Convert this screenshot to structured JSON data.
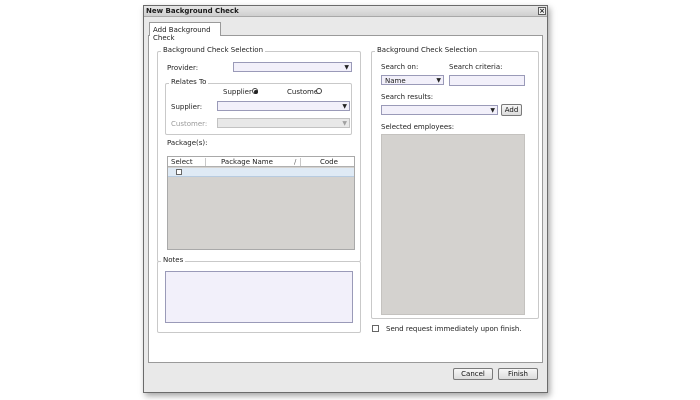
{
  "window": {
    "title": "New Background Check",
    "close_glyph": "×"
  },
  "tabs": [
    {
      "label": "Add Background Check"
    }
  ],
  "left_group": {
    "title": "Background Check Selection",
    "provider_label": "Provider:",
    "provider_value": "",
    "relates_to": {
      "title": "Relates To",
      "supplier_option": "Supplier",
      "customer_option": "Customer",
      "selected": "Supplier",
      "supplier_label": "Supplier:",
      "supplier_value": "",
      "customer_label": "Customer:",
      "customer_value": ""
    },
    "packages_label": "Package(s):",
    "packages_table": {
      "columns": [
        "Select",
        "Package Name",
        "Code"
      ],
      "sort_glyph": "/",
      "rows": [
        {
          "selected": false,
          "name": "",
          "code": ""
        }
      ]
    }
  },
  "notes_group": {
    "title": "Notes",
    "value": ""
  },
  "right_group": {
    "title": "Background Check Selection",
    "search_on_label": "Search on:",
    "search_on_value": "Name",
    "search_criteria_label": "Search criteria:",
    "search_criteria_value": "",
    "search_results_label": "Search results:",
    "search_results_value": "",
    "add_button": "Add",
    "selected_employees_label": "Selected employees:"
  },
  "send_request": {
    "label": "Send request immediately upon finish.",
    "checked": false
  },
  "footer": {
    "cancel_button": "Cancel",
    "finish_button": "Finish"
  },
  "icons": {
    "dropdown_arrow": "▼"
  }
}
